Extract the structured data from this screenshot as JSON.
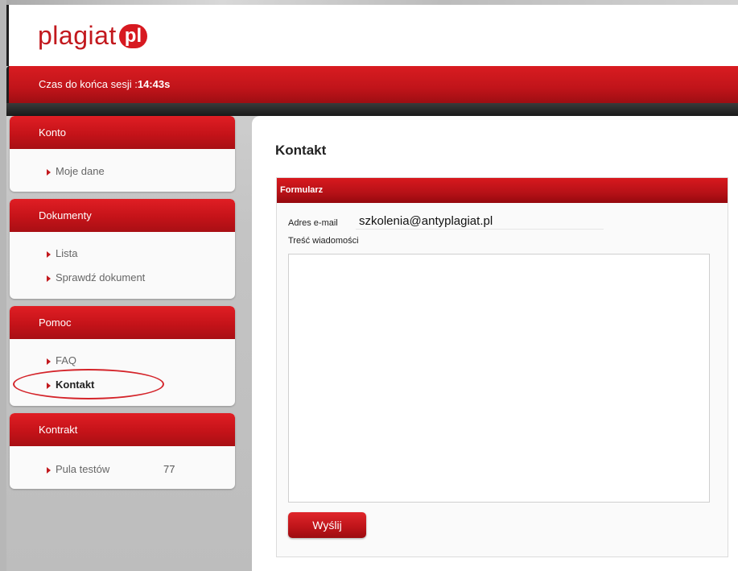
{
  "brand": {
    "logo_text": "plagiat",
    "logo_badge": "pl"
  },
  "session": {
    "label": "Czas do końca sesji :",
    "time": "14:43s"
  },
  "sidebar": {
    "sections": [
      {
        "title": "Konto",
        "items": [
          {
            "label": "Moje dane"
          }
        ]
      },
      {
        "title": "Dokumenty",
        "items": [
          {
            "label": "Lista"
          },
          {
            "label": "Sprawdź dokument"
          }
        ]
      },
      {
        "title": "Pomoc",
        "items": [
          {
            "label": "FAQ"
          },
          {
            "label": "Kontakt",
            "active": true
          }
        ]
      },
      {
        "title": "Kontrakt",
        "items": [
          {
            "label": "Pula testów",
            "count": "77"
          }
        ]
      }
    ]
  },
  "main": {
    "title": "Kontakt",
    "form": {
      "header": "Formularz",
      "email_label": "Adres e-mail",
      "email_value": "szkolenia@antyplagiat.pl",
      "message_label": "Treść wiadomości",
      "message_value": "",
      "submit_label": "Wyślij"
    }
  },
  "colors": {
    "brand_red": "#c2181d",
    "highlight_ring": "#d4242a"
  },
  "icons": {
    "menu_bullet": "triangle-right-icon"
  }
}
